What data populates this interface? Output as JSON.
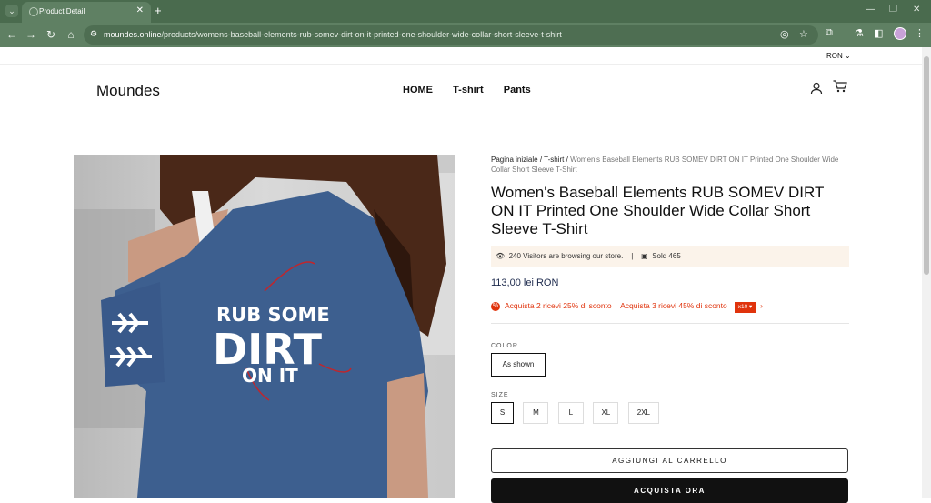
{
  "browser": {
    "tab_title": "Product Detail",
    "url_domain": "moundes.online",
    "url_path": "/products/womens-baseball-elements-rub-somev-dirt-on-it-printed-one-shoulder-wide-collar-short-sleeve-t-shirt"
  },
  "site": {
    "currency": "RON",
    "logo": "Moundes",
    "nav": [
      "HOME",
      "T-shirt",
      "Pants"
    ]
  },
  "product": {
    "breadcrumb": {
      "home": "Pagina iniziale",
      "category": "T-shirt",
      "current": "Women's Baseball Elements RUB SOMEV DIRT ON IT Printed One Shoulder Wide Collar Short Sleeve T-Shirt"
    },
    "title": "Women's Baseball Elements RUB SOMEV DIRT ON IT Printed One Shoulder Wide Collar Short Sleeve T-Shirt",
    "visitors_text": "240 Visitors are browsing our store.",
    "sold_text": "Sold 465",
    "price": "113,00 lei RON",
    "promo_1": "Acquista 2 ricevi 25% di sconto",
    "promo_2": "Acquista 3 ricevi 45% di sconto",
    "promo_tag": "x10",
    "color_label": "COLOR",
    "color_selected": "As shown",
    "size_label": "SIZE",
    "sizes": [
      "S",
      "M",
      "L",
      "XL",
      "2XL"
    ],
    "selected_size": "S",
    "add_to_cart": "AGGIUNGI AL CARRELLO",
    "buy_now": "ACQUISTA ORA"
  },
  "shirt_print": {
    "line1": "RUB SOME",
    "line2": "DIRT",
    "line3": "ON IT"
  },
  "colors": {
    "browser_frame": "#4a6b4e",
    "accent_red": "#e0330c",
    "visitor_bg": "#fbf3ea",
    "shirt_blue": "#3d5f8f",
    "price_navy": "#1d2a4d"
  },
  "icons": [
    "tab-list-icon",
    "close-icon",
    "plus-icon",
    "minimize-icon",
    "restore-icon",
    "back-icon",
    "forward-icon",
    "reload-icon",
    "home-icon",
    "site-settings-icon",
    "eye-off-icon",
    "star-icon",
    "extensions-icon",
    "flask-icon",
    "sidebar-icon",
    "menu-icon",
    "user-icon",
    "cart-icon",
    "eye-icon",
    "bag-icon",
    "percent-icon",
    "chevron-right-icon"
  ]
}
